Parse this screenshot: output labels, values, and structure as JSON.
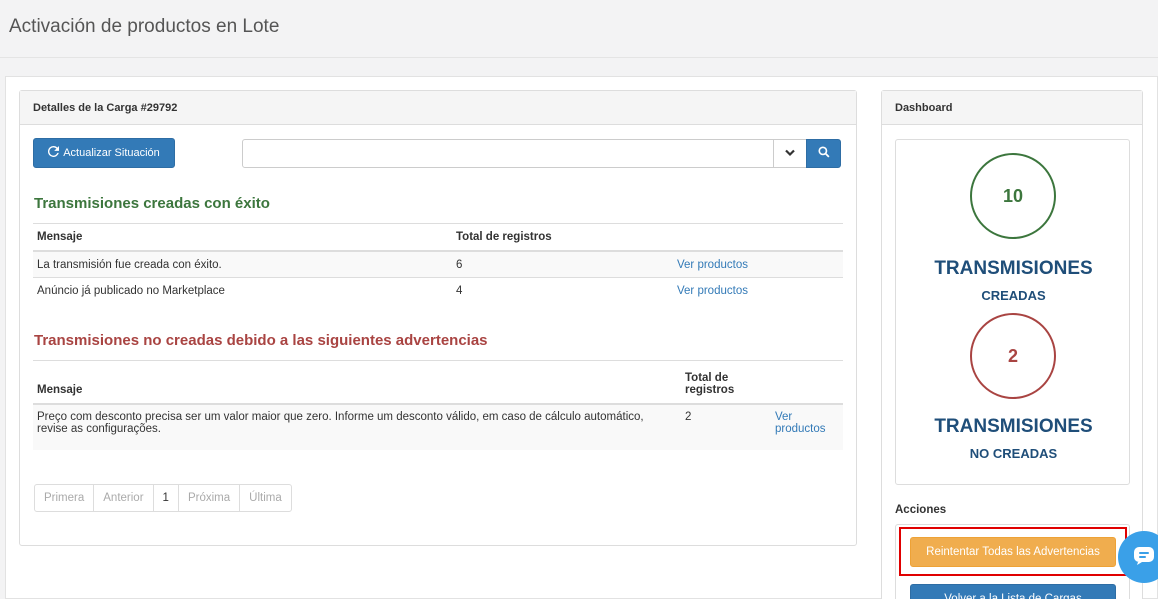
{
  "page": {
    "title": "Activación de productos en Lote"
  },
  "details": {
    "heading": "Detalles de la Carga #29792",
    "refresh_label": "Actualizar Situación",
    "search": {
      "value": "",
      "placeholder": ""
    },
    "success": {
      "title": "Transmisiones creadas con éxito",
      "headers": [
        "Mensaje",
        "Total de registros"
      ],
      "rows": [
        {
          "message": "La transmisión fue creada con éxito.",
          "total": "6",
          "link": "Ver productos"
        },
        {
          "message": "Anúncio já publicado no Marketplace",
          "total": "4",
          "link": "Ver productos"
        }
      ]
    },
    "warnings": {
      "title": "Transmisiones no creadas debido a las siguientes advertencias",
      "headers": [
        "Mensaje",
        "Total de registros"
      ],
      "rows": [
        {
          "message": "Preço com desconto precisa ser um valor maior que zero. Informe um desconto válido, em caso de cálculo automático, revise as configurações.",
          "total": "2",
          "link": "Ver productos"
        }
      ]
    },
    "pagination": [
      "Primera",
      "Anterior",
      "1",
      "Próxima",
      "Última"
    ]
  },
  "dashboard": {
    "heading": "Dashboard",
    "created": {
      "count": "10",
      "label_big": "TRANSMISIONES",
      "label_small": "CREADAS",
      "color": "#3c763d"
    },
    "not_created": {
      "count": "2",
      "label_big": "TRANSMISIONES",
      "label_small": "NO CREADAS",
      "color": "#a94442"
    },
    "actions_label": "Acciones",
    "retry_label": "Reintentar Todas las Advertencias",
    "back_label": "Volver a la Lista de Cargas"
  },
  "icons": {
    "refresh": "refresh-icon",
    "caret": "chevron-down-icon",
    "search": "search-icon",
    "chat": "chat-icon"
  }
}
